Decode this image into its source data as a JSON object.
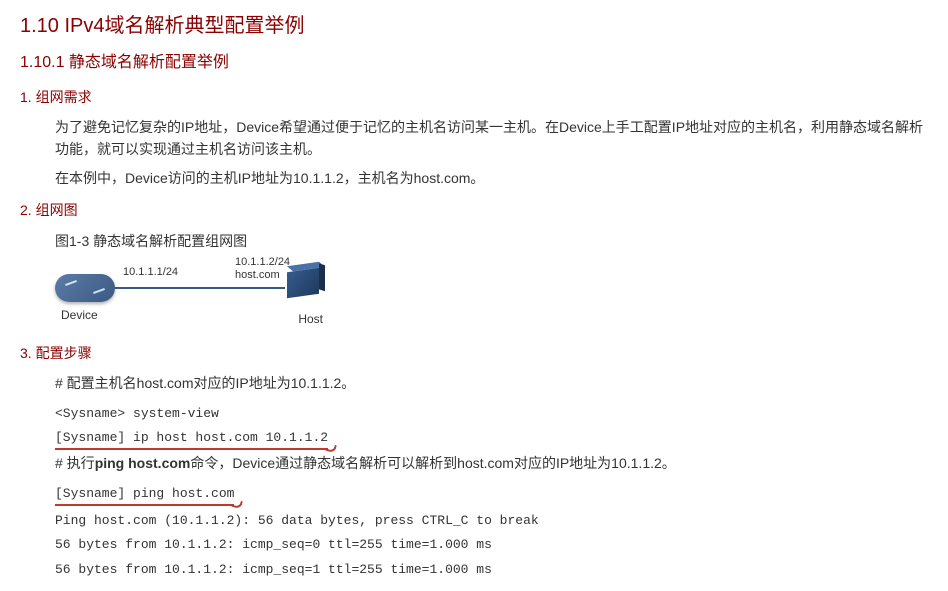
{
  "heading1": "1.10  IPv4域名解析典型配置举例",
  "heading2": "1.10.1  静态域名解析配置举例",
  "sec1_title": "1. 组网需求",
  "sec1_p1": "为了避免记忆复杂的IP地址，Device希望通过便于记忆的主机名访问某一主机。在Device上手工配置IP地址对应的主机名，利用静态域名解析功能，就可以实现通过主机名访问该主机。",
  "sec1_p2": "在本例中，Device访问的主机IP地址为10.1.1.2，主机名为host.com。",
  "sec2_title": "2. 组网图",
  "fig_caption": "图1-3 静态域名解析配置组网图",
  "diagram": {
    "device_label": "Device",
    "host_label": "Host",
    "ip_left": "10.1.1.1/24",
    "ip_right_line1": "10.1.1.2/24",
    "ip_right_line2": "host.com"
  },
  "sec3_title": "3. 配置步骤",
  "step1": "# 配置主机名host.com对应的IP地址为10.1.1.2。",
  "cmd1": "<Sysname> system-view",
  "cmd2": "[Sysname] ip host host.com 10.1.1.2",
  "step2_pre": "# 执行",
  "step2_bold": "ping host.com",
  "step2_post": "命令，Device通过静态域名解析可以解析到host.com对应的IP地址为10.1.1.2。",
  "cmd3": "[Sysname] ping host.com",
  "out1": "Ping host.com (10.1.1.2): 56 data bytes, press CTRL_C to break",
  "out2": "56 bytes from 10.1.1.2: icmp_seq=0 ttl=255 time=1.000 ms",
  "out3": "56 bytes from 10.1.1.2: icmp_seq=1 ttl=255 time=1.000 ms"
}
